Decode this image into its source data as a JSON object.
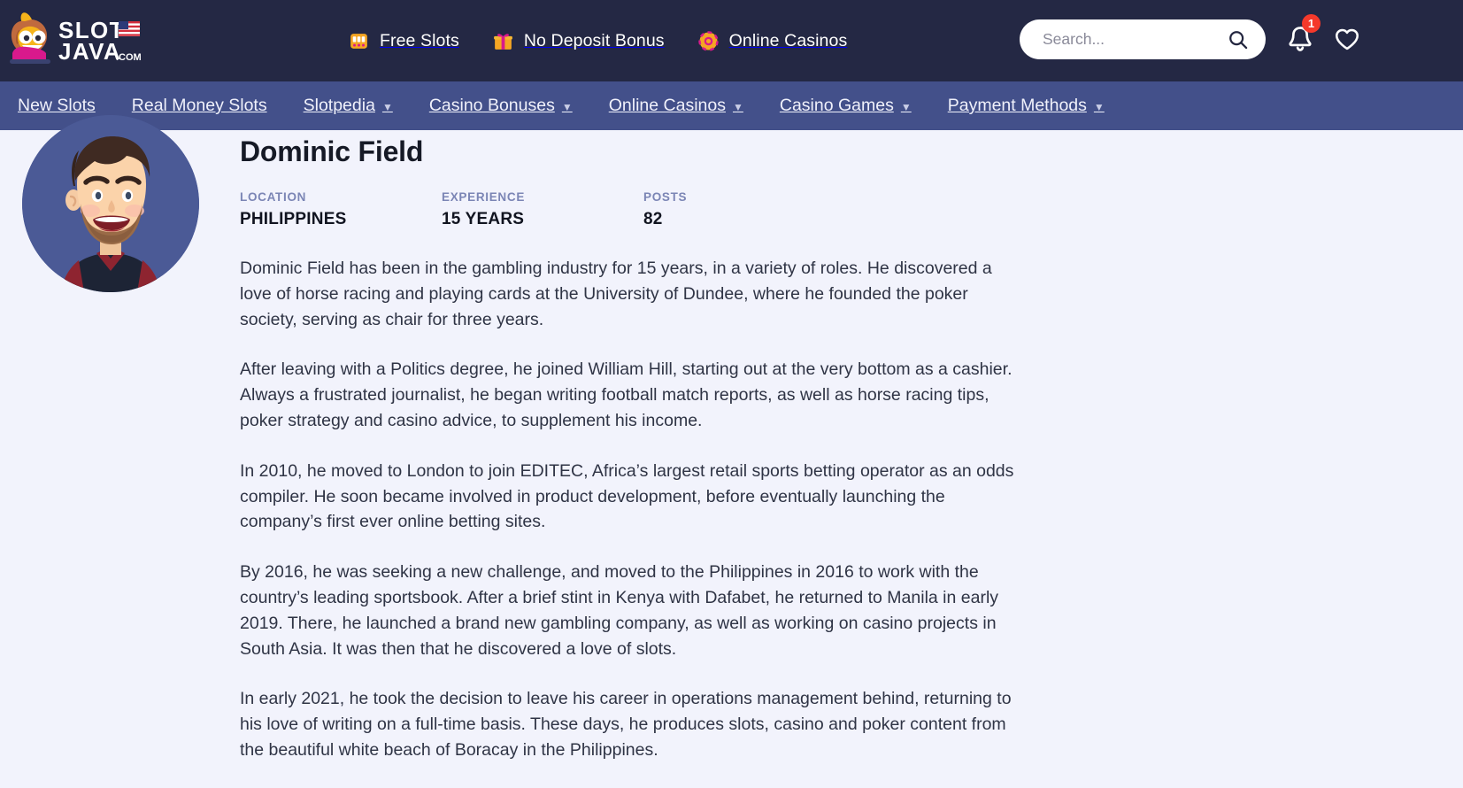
{
  "brand": {
    "name": "SLOT JAVA",
    "line1": "SLOT",
    "line2": "JAVA",
    "tld": ".COM",
    "flag": "us-flag-icon",
    "colors": {
      "topbar": "#242844",
      "nav": "#43508a",
      "page_bg": "#f2f3fc",
      "badge": "#f5392b",
      "accent_gold": "#f5a623"
    }
  },
  "quick_nav": [
    {
      "label": "Free Slots",
      "icon": "slot-machine-icon"
    },
    {
      "label": "No Deposit Bonus",
      "icon": "gift-icon"
    },
    {
      "label": "Online Casinos",
      "icon": "casino-chip-icon"
    }
  ],
  "search": {
    "placeholder": "Search...",
    "value": "",
    "icon": "search-icon"
  },
  "notifications": {
    "count": "1",
    "icon": "bell-icon"
  },
  "favorites": {
    "icon": "heart-icon"
  },
  "main_nav": [
    {
      "label": "New Slots",
      "has_dropdown": false
    },
    {
      "label": "Real Money Slots",
      "has_dropdown": false
    },
    {
      "label": "Slotpedia",
      "has_dropdown": true
    },
    {
      "label": "Casino Bonuses",
      "has_dropdown": true
    },
    {
      "label": "Online Casinos",
      "has_dropdown": true
    },
    {
      "label": "Casino Games",
      "has_dropdown": true
    },
    {
      "label": "Payment Methods",
      "has_dropdown": true
    }
  ],
  "caret_glyph": "▼",
  "profile": {
    "avatar_name": "author-avatar",
    "name": "Dominic Field",
    "stats": [
      {
        "label": "LOCATION",
        "value": "PHILIPPINES"
      },
      {
        "label": "EXPERIENCE",
        "value": "15 YEARS"
      },
      {
        "label": "POSTS",
        "value": "82"
      }
    ],
    "bio": [
      "Dominic Field has been in the gambling industry for 15 years, in a variety of roles. He discovered a love of horse racing and playing cards at the University of Dundee, where he founded the poker society, serving as chair for three years.",
      "After leaving with a Politics degree, he joined William Hill, starting out at the very bottom as a cashier. Always a frustrated journalist, he began writing football match reports, as well as horse racing tips, poker strategy and casino advice, to supplement his income.",
      "In 2010, he moved to London to join EDITEC, Africa’s largest retail sports betting operator as an odds compiler. He soon became involved in product development, before eventually launching the company’s first ever online betting sites.",
      "By 2016, he was seeking a new challenge, and moved to the Philippines in 2016 to work with the country’s leading sportsbook. After a brief stint in Kenya with Dafabet, he returned to Manila in early 2019. There, he launched a brand new gambling company, as well as working on casino projects in South Asia. It was then that he discovered a love of slots.",
      "In early 2021, he took the decision to leave his career in operations management behind, returning to his love of writing on a full-time basis. These days, he produces slots, casino and poker content from the beautiful white beach of Boracay in the Philippines."
    ]
  }
}
